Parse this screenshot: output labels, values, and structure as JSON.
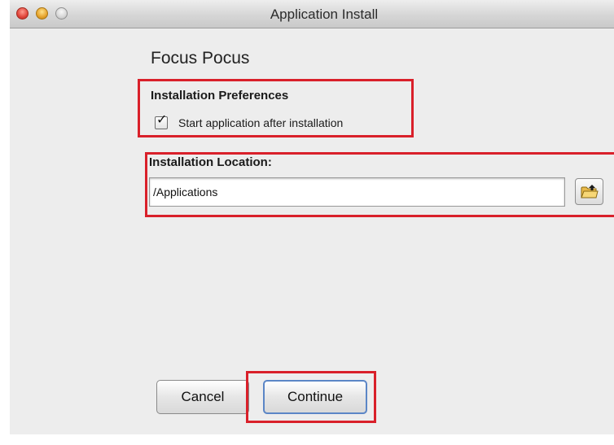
{
  "window": {
    "title": "Application Install"
  },
  "app": {
    "name": "Focus Pocus"
  },
  "preferences": {
    "heading": "Installation Preferences",
    "start_after_install_label": "Start application after installation",
    "start_after_install_checked": true
  },
  "location": {
    "heading": "Installation Location:",
    "path": "/Applications",
    "browse_icon": "folder-icon"
  },
  "buttons": {
    "cancel": "Cancel",
    "continue": "Continue"
  },
  "colors": {
    "highlight": "#d9202a",
    "default_button_border": "#5b86c6"
  }
}
